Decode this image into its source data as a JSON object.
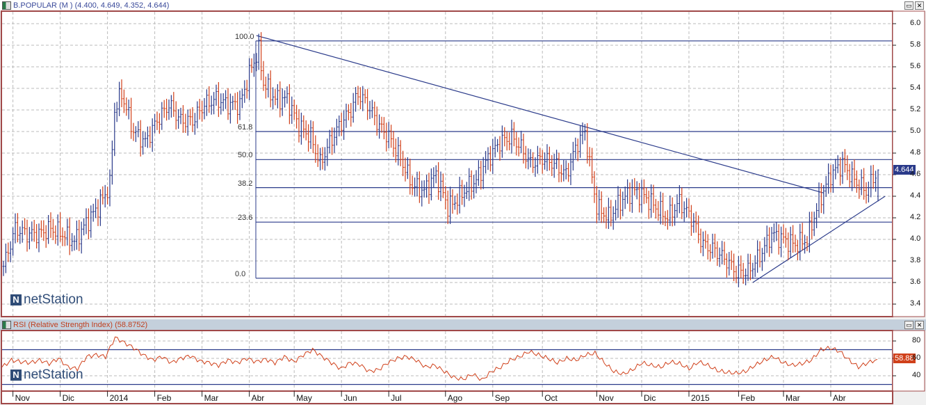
{
  "main_panel": {
    "title": "B.POPULAR (M ) (4.400, 4.649, 4.352, 4.644)",
    "last_price": "4.644",
    "logo": "netStation"
  },
  "rsi_panel": {
    "title": "RSI (Relative Strength Index) (58.8752)",
    "last_value": "58.88",
    "logo": "netStation"
  },
  "colors": {
    "up": "#2a3a8a",
    "down": "#d0401a",
    "fib": "#2a3a8a",
    "rsi": "#d0401a",
    "border": "#a04848"
  },
  "chart_data": [
    {
      "type": "bar",
      "title": "B.POPULAR (M )",
      "ylim": [
        3.3,
        6.1
      ],
      "y_ticks": [
        "6.0",
        "5.8",
        "5.6",
        "5.4",
        "5.2",
        "5.0",
        "4.8",
        "4.6",
        "4.4",
        "4.2",
        "4.0",
        "3.8",
        "3.6",
        "3.4"
      ],
      "x_ticks": [
        "Nov",
        "Dic",
        "2014",
        "Feb",
        "Mar",
        "Abr",
        "May",
        "Jun",
        "Jul",
        "Ago",
        "Sep",
        "Oct",
        "Nov",
        "Dic",
        "2015",
        "Feb",
        "Mar",
        "Abr"
      ],
      "x_tick_days": [
        4,
        24,
        44,
        64,
        84,
        104,
        123,
        143,
        163,
        187,
        207,
        228,
        251,
        270,
        290,
        311,
        330,
        350
      ],
      "fib_levels": [
        {
          "label": "100.0",
          "price": 5.84
        },
        {
          "label": "61.8",
          "price": 5.0
        },
        {
          "label": "50.0",
          "price": 4.74
        },
        {
          "label": "38.2",
          "price": 4.48
        },
        {
          "label": "23.6",
          "price": 4.16
        },
        {
          "label": "0.0",
          "price": 3.64
        }
      ],
      "trendlines": [
        {
          "from": [
            107,
            5.89
          ],
          "to": [
            347,
            4.43
          ]
        },
        {
          "from": [
            317,
            3.6
          ],
          "to": [
            373,
            4.4
          ]
        }
      ],
      "close_points": [
        [
          0,
          3.75
        ],
        [
          5,
          4.1
        ],
        [
          10,
          4.05
        ],
        [
          15,
          4.05
        ],
        [
          20,
          4.1
        ],
        [
          25,
          4.05
        ],
        [
          30,
          3.98
        ],
        [
          35,
          4.15
        ],
        [
          40,
          4.3
        ],
        [
          45,
          4.5
        ],
        [
          47,
          5.2
        ],
        [
          50,
          5.35
        ],
        [
          55,
          5.0
        ],
        [
          60,
          4.9
        ],
        [
          65,
          5.1
        ],
        [
          70,
          5.25
        ],
        [
          75,
          5.1
        ],
        [
          80,
          5.1
        ],
        [
          85,
          5.25
        ],
        [
          90,
          5.3
        ],
        [
          95,
          5.25
        ],
        [
          100,
          5.25
        ],
        [
          105,
          5.6
        ],
        [
          108,
          5.75
        ],
        [
          110,
          5.45
        ],
        [
          115,
          5.3
        ],
        [
          120,
          5.3
        ],
        [
          125,
          5.05
        ],
        [
          130,
          4.95
        ],
        [
          134,
          4.7
        ],
        [
          137,
          4.85
        ],
        [
          142,
          5.05
        ],
        [
          147,
          5.2
        ],
        [
          150,
          5.35
        ],
        [
          154,
          5.25
        ],
        [
          159,
          5.05
        ],
        [
          163,
          4.95
        ],
        [
          168,
          4.75
        ],
        [
          173,
          4.5
        ],
        [
          178,
          4.45
        ],
        [
          183,
          4.6
        ],
        [
          188,
          4.3
        ],
        [
          191,
          4.35
        ],
        [
          195,
          4.45
        ],
        [
          200,
          4.55
        ],
        [
          205,
          4.75
        ],
        [
          210,
          4.9
        ],
        [
          215,
          4.95
        ],
        [
          219,
          4.85
        ],
        [
          223,
          4.7
        ],
        [
          228,
          4.75
        ],
        [
          233,
          4.7
        ],
        [
          238,
          4.6
        ],
        [
          243,
          4.9
        ],
        [
          246,
          5.0
        ],
        [
          248,
          4.7
        ],
        [
          251,
          4.3
        ],
        [
          256,
          4.2
        ],
        [
          261,
          4.35
        ],
        [
          266,
          4.45
        ],
        [
          271,
          4.4
        ],
        [
          276,
          4.3
        ],
        [
          281,
          4.2
        ],
        [
          286,
          4.35
        ],
        [
          291,
          4.2
        ],
        [
          296,
          3.95
        ],
        [
          301,
          3.9
        ],
        [
          306,
          3.8
        ],
        [
          310,
          3.7
        ],
        [
          315,
          3.7
        ],
        [
          320,
          3.85
        ],
        [
          325,
          4.05
        ],
        [
          330,
          4.0
        ],
        [
          335,
          3.95
        ],
        [
          340,
          4.0
        ],
        [
          345,
          4.35
        ],
        [
          350,
          4.6
        ],
        [
          355,
          4.7
        ],
        [
          360,
          4.55
        ],
        [
          365,
          4.45
        ],
        [
          370,
          4.644
        ]
      ],
      "last": {
        "open": 4.4,
        "high": 4.649,
        "low": 4.352,
        "close": 4.644
      }
    },
    {
      "type": "line",
      "title": "RSI (Relative Strength Index)",
      "ylim": [
        25,
        92
      ],
      "y_ticks": [
        "80",
        "60",
        "40"
      ],
      "levels": [
        70,
        30
      ],
      "values": [
        50,
        58,
        56,
        55,
        58,
        54,
        60,
        50,
        48,
        62,
        64,
        62,
        84,
        78,
        72,
        64,
        58,
        62,
        55,
        60,
        63,
        57,
        55,
        52,
        58,
        55,
        60,
        56,
        59,
        55,
        62,
        56,
        64,
        70,
        62,
        55,
        48,
        55,
        53,
        45,
        47,
        55,
        60,
        62,
        58,
        50,
        52,
        45,
        38,
        36,
        42,
        35,
        45,
        50,
        58,
        62,
        68,
        64,
        60,
        55,
        60,
        58,
        64,
        66,
        55,
        45,
        42,
        47,
        55,
        52,
        50,
        56,
        54,
        48,
        56,
        52,
        46,
        44,
        43,
        45,
        52,
        58,
        62,
        55,
        52,
        54,
        58,
        70,
        72,
        68,
        58,
        50,
        55,
        58.88
      ]
    }
  ]
}
